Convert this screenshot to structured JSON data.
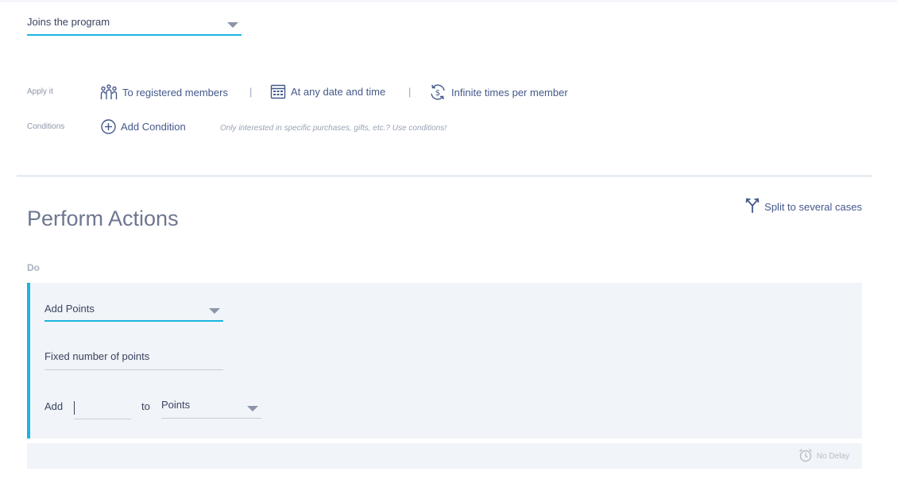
{
  "trigger": {
    "selected": "Joins the program"
  },
  "apply": {
    "label": "Apply it",
    "members": "To registered members",
    "time": "At any date and time",
    "frequency": "Infinite times per member",
    "separator": "|"
  },
  "conditions": {
    "label": "Conditions",
    "add_label": "Add Condition",
    "hint": "Only interested in specific purchases, gifts, etc.? Use conditions!"
  },
  "actions": {
    "title": "Perform Actions",
    "split_label": "Split to several cases",
    "do_label": "Do",
    "action_type": "Add Points",
    "points_mode": "Fixed number of points",
    "add_label": "Add",
    "amount_value": "",
    "to_label": "to",
    "target": "Points",
    "delay_label": "No Delay"
  }
}
